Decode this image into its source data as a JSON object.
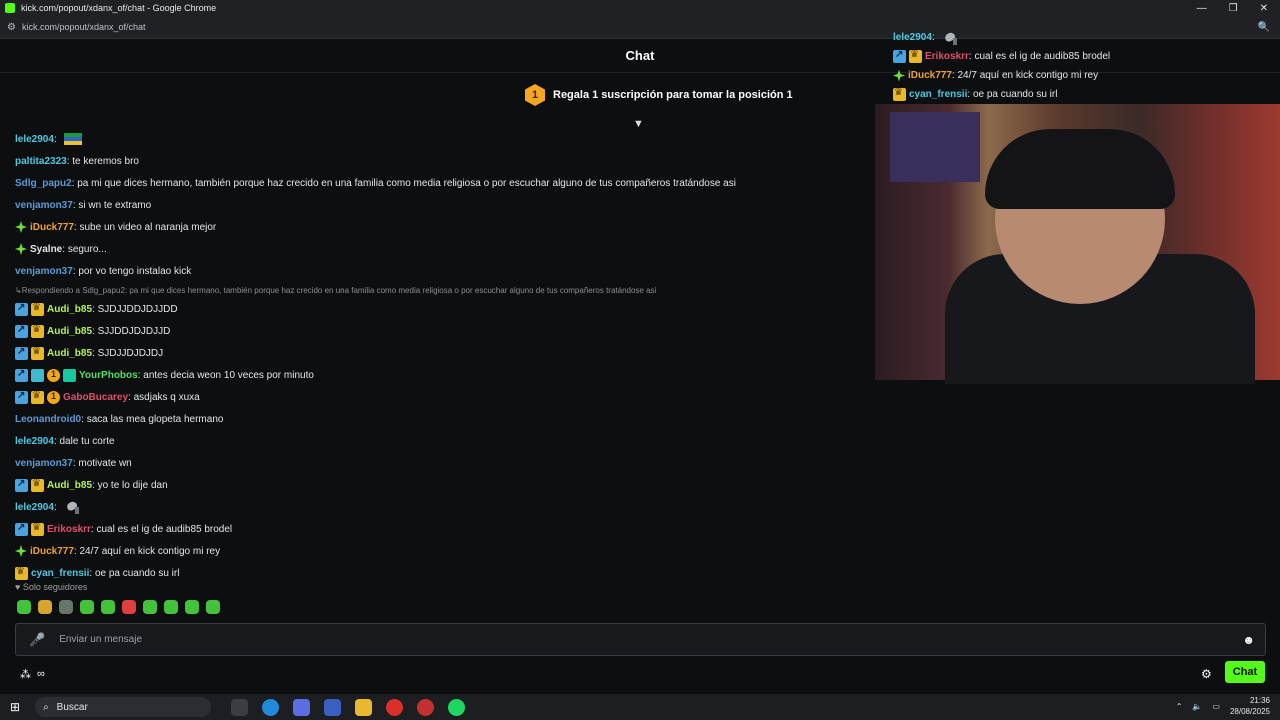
{
  "window": {
    "title": "kick.com/popout/xdanx_of/chat - Google Chrome",
    "url": "kick.com/popout/xdanx_of/chat"
  },
  "chat": {
    "title": "Chat",
    "pinned": {
      "rank": "1",
      "text": "Regala 1 suscripción para tomar la posición 1"
    }
  },
  "messages": [
    {
      "user": "lele2904",
      "color": "#4ec9e0",
      "text": "",
      "emote": "flag",
      "badges": []
    },
    {
      "user": "paltita2323",
      "color": "#4ec9e0",
      "text": "te keremos bro",
      "badges": []
    },
    {
      "user": "Sdlg_papu2",
      "color": "#5b9bd5",
      "text": "pa mi que dices hermano, también porque haz crecido en una familia como media religiosa o por escuchar alguno de tus compañeros tratándose asi",
      "badges": []
    },
    {
      "user": "venjamon37",
      "color": "#5b9bd5",
      "text": "si wn te extramo",
      "badges": []
    },
    {
      "user": "iDuck777",
      "color": "#f0a030",
      "text": "sube un video al naranja mejor",
      "badges": [
        "gem"
      ]
    },
    {
      "user": "Syalne",
      "color": "#e6e6e6",
      "text": "seguro...",
      "badges": [
        "gem"
      ]
    },
    {
      "user": "venjamon37",
      "color": "#5b9bd5",
      "text": "por vo tengo instalao kick",
      "badges": []
    },
    {
      "reply": "Respondiendo a Sdlg_papu2: pa mi que dices hermano, también porque haz crecido en una familia como media religiosa o por escuchar alguno de tus compañeros tratándose asi"
    },
    {
      "user": "Audi_b85",
      "color": "#b6f05a",
      "text": "SJDJJDDJDJJDD",
      "badges": [
        "sub",
        "crown"
      ]
    },
    {
      "user": "Audi_b85",
      "color": "#b6f05a",
      "text": "SJJDDJDJDJJD",
      "badges": [
        "sub",
        "crown"
      ]
    },
    {
      "user": "Audi_b85",
      "color": "#b6f05a",
      "text": "SJDJJDJDJDJ",
      "badges": [
        "sub",
        "crown"
      ]
    },
    {
      "user": "YourPhobos",
      "color": "#4ee06b",
      "text": "antes decia weon 10 veces por minuto",
      "badges": [
        "sub",
        "grid",
        "coin",
        "gift"
      ]
    },
    {
      "user": "GaboBucarey",
      "color": "#e0506b",
      "text": "asdjaks q xuxa",
      "badges": [
        "sub",
        "crown",
        "coin"
      ]
    },
    {
      "user": "Leonandroid0",
      "color": "#5b9bd5",
      "text": "saca las mea glopeta hermano",
      "badges": []
    },
    {
      "user": "lele2904",
      "color": "#4ec9e0",
      "text": "dale tu corte",
      "badges": []
    },
    {
      "user": "venjamon37",
      "color": "#5b9bd5",
      "text": "motivate wn",
      "badges": []
    },
    {
      "user": "Audi_b85",
      "color": "#b6f05a",
      "text": "yo te lo dije dan",
      "badges": [
        "sub",
        "crown"
      ]
    },
    {
      "user": "lele2904",
      "color": "#4ec9e0",
      "text": "",
      "emote": "bird",
      "badges": []
    },
    {
      "user": "Erikoskrr",
      "color": "#e0506b",
      "text": "cual es el ig de audib85 brodel",
      "badges": [
        "sub",
        "crown"
      ]
    },
    {
      "user": "iDuck777",
      "color": "#f0a030",
      "text": "24/7 aquí en kick contigo mi rey",
      "badges": [
        "gem"
      ]
    },
    {
      "user": "cyan_frensii",
      "color": "#4ec9e0",
      "text": "oe pa cuando su irl",
      "badges": [
        "crown"
      ]
    }
  ],
  "overlay": [
    {
      "user": "lele2904",
      "color": "#4ec9e0",
      "text": "",
      "emote": "bird",
      "badges": []
    },
    {
      "user": "Erikoskrr",
      "color": "#e0506b",
      "text": "cual es el ig de audib85 brodel",
      "badges": [
        "sub",
        "crown"
      ]
    },
    {
      "user": "iDuck777",
      "color": "#f0a030",
      "text": "24/7 aquí en kick contigo mi rey",
      "badges": [
        "gem"
      ]
    },
    {
      "user": "cyan_frensii",
      "color": "#4ec9e0",
      "text": "oe pa cuando su irl",
      "badges": [
        "crown"
      ]
    }
  ],
  "followers_only": "Solo seguidores",
  "input": {
    "placeholder": "Enviar un mensaje"
  },
  "chat_button": "Chat",
  "taskbar": {
    "search": "Buscar",
    "time": "21:36",
    "date": "28/08/2025"
  },
  "colors": {
    "accent": "#53fc18",
    "background": "#0c0e10"
  }
}
